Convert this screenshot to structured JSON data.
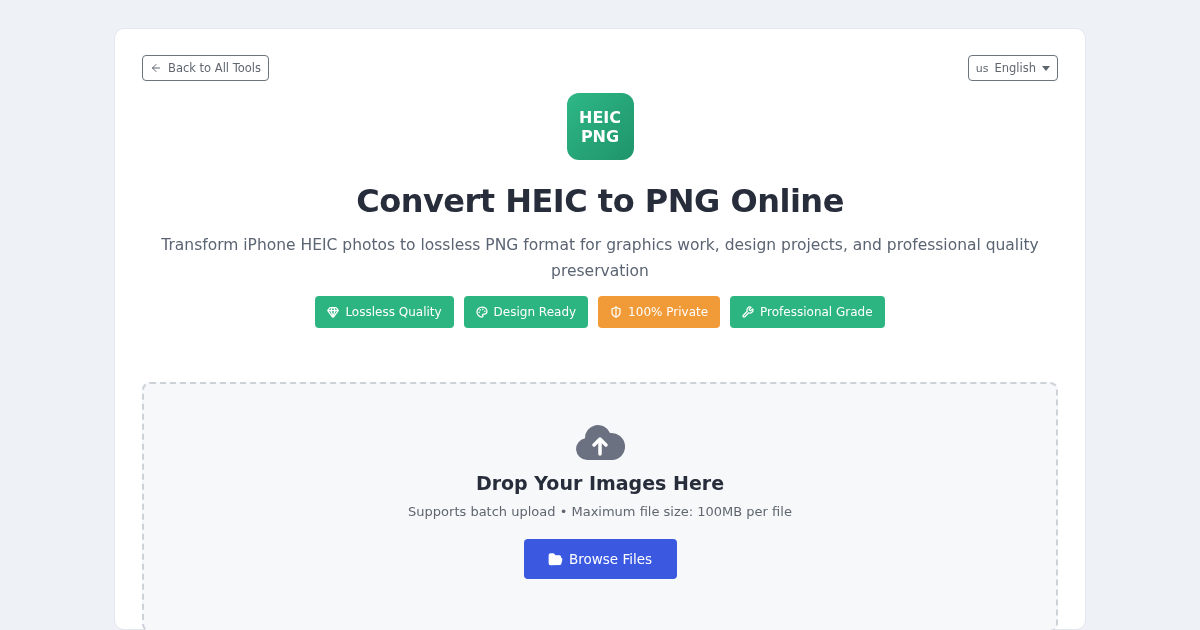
{
  "back_link": {
    "label": "Back to All Tools"
  },
  "language": {
    "flag": "us",
    "label": "English"
  },
  "logo": {
    "lines": [
      "HEIC",
      "PNG"
    ]
  },
  "title": "Convert HEIC to PNG Online",
  "subtitle": "Transform iPhone HEIC photos to lossless PNG format for graphics work, design projects, and professional quality preservation",
  "badges": [
    {
      "label": "Lossless Quality",
      "kind": "gem",
      "color": "#2db581"
    },
    {
      "label": "Design Ready",
      "kind": "palette",
      "color": "#2db581"
    },
    {
      "label": "100% Private",
      "kind": "shield",
      "color": "#f09a38"
    },
    {
      "label": "Professional Grade",
      "kind": "tools",
      "color": "#2db581"
    }
  ],
  "dropzone": {
    "heading": "Drop Your Images Here",
    "hint": "Supports batch upload • Maximum file size: 100MB per file",
    "button": "Browse Files"
  }
}
